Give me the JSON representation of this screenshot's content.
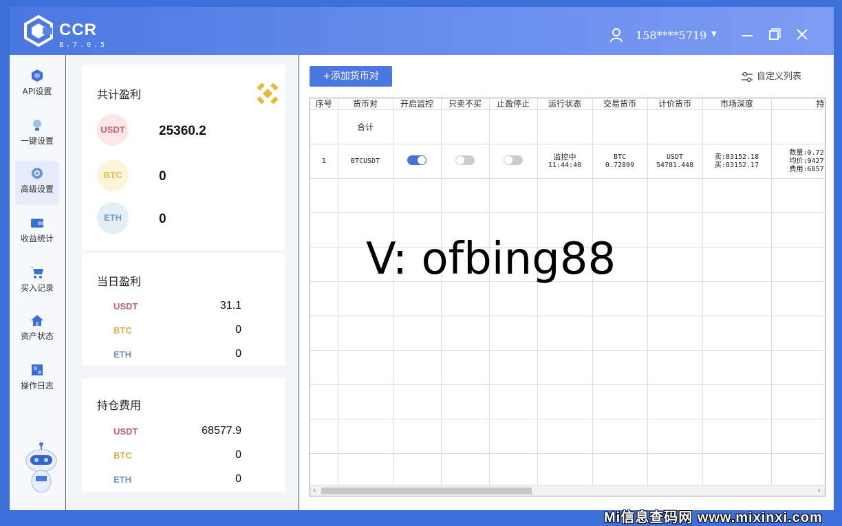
{
  "app": {
    "name": "CCR",
    "version": "8.7.0.5",
    "user": "158****5719"
  },
  "sidebar": {
    "items": [
      {
        "label": "API设置",
        "icon": "cube-icon"
      },
      {
        "label": "一键设置",
        "icon": "lightbulb-icon"
      },
      {
        "label": "高级设置",
        "icon": "gear-icon"
      },
      {
        "label": "收益统计",
        "icon": "wallet-icon"
      },
      {
        "label": "买入记录",
        "icon": "cart-icon"
      },
      {
        "label": "资产状态",
        "icon": "home-icon"
      },
      {
        "label": "操作日志",
        "icon": "log-icon"
      }
    ],
    "active_index": 2
  },
  "total_profit": {
    "title": "共计盈利",
    "coins": [
      {
        "name": "USDT",
        "value": "25360.2"
      },
      {
        "name": "BTC",
        "value": "0"
      },
      {
        "name": "ETH",
        "value": "0"
      }
    ]
  },
  "daily_profit": {
    "title": "当日盈利",
    "coins": [
      {
        "name": "USDT",
        "value": "31.1"
      },
      {
        "name": "BTC",
        "value": "0"
      },
      {
        "name": "ETH",
        "value": "0"
      }
    ]
  },
  "holding_cost": {
    "title": "持仓费用",
    "coins": [
      {
        "name": "USDT",
        "value": "68577.9"
      },
      {
        "name": "BTC",
        "value": "0"
      },
      {
        "name": "ETH",
        "value": "0"
      }
    ]
  },
  "toolbar": {
    "add_label": "+添加货币对",
    "custom_cols_label": "自定义列表"
  },
  "table": {
    "headers": [
      "序号",
      "货币对",
      "开启监控",
      "只卖不买",
      "止盈停止",
      "运行状态",
      "交易货币",
      "计价货币",
      "市场深度",
      "持仓数"
    ],
    "total_label": "合计",
    "row": {
      "index": "1",
      "pair": "BTCUSDT",
      "monitor_on": true,
      "sell_only_on": false,
      "tp_stop_on": false,
      "status_line1": "监控中",
      "status_line2": "11:44:40",
      "trade_line1": "BTC",
      "trade_line2": "0.72899",
      "quote_line1": "USDT",
      "quote_line2": "54781.448",
      "depth_line1": "卖:83152.18",
      "depth_line2": "买:83152.17",
      "pos_line1": "数量:0.72",
      "pos_line2": "均价:9427",
      "pos_line3": "费用:6857"
    },
    "scroll_fraction": 0.41
  },
  "watermark": "V:  ofbing88",
  "site_watermark": "Mi信息查码网 www.mixinxi.com"
}
